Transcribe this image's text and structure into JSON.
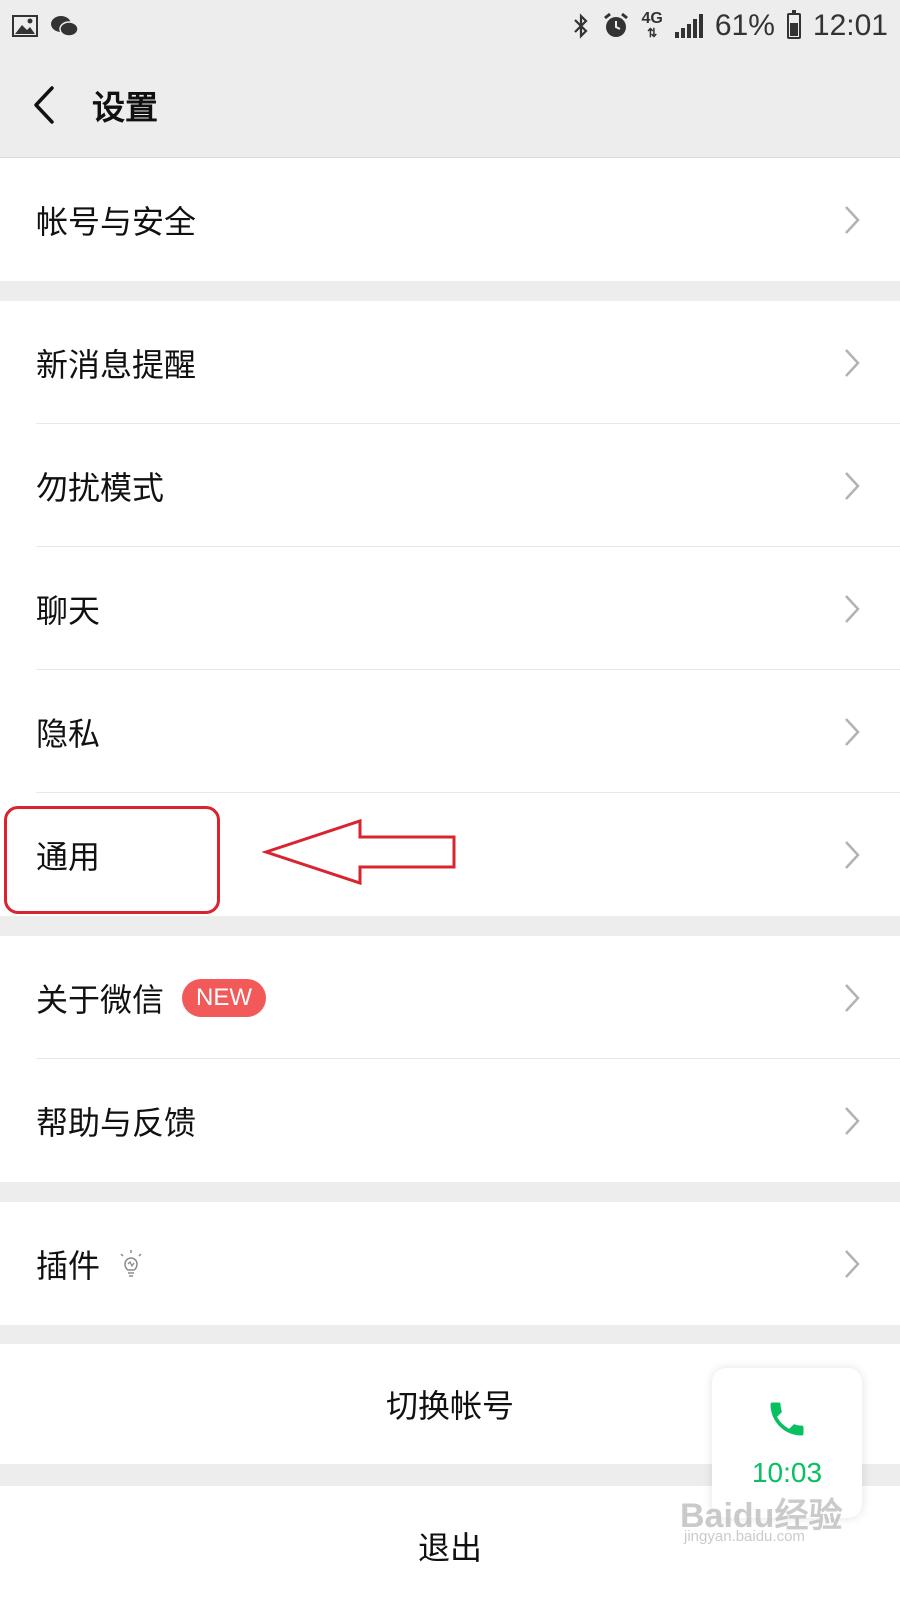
{
  "status_bar": {
    "battery": "61%",
    "time": "12:01",
    "network": "4G",
    "icons": [
      "gallery-icon",
      "wechat-icon",
      "bluetooth-icon",
      "alarm-icon",
      "signal-icon",
      "battery-icon"
    ]
  },
  "header": {
    "title": "设置",
    "back_icon": "chevron-left-icon"
  },
  "groups": [
    {
      "items": [
        {
          "label": "帐号与安全"
        }
      ]
    },
    {
      "items": [
        {
          "label": "新消息提醒"
        },
        {
          "label": "勿扰模式"
        },
        {
          "label": "聊天"
        },
        {
          "label": "隐私"
        },
        {
          "label": "通用"
        }
      ]
    },
    {
      "items": [
        {
          "label": "关于微信",
          "badge": "NEW"
        },
        {
          "label": "帮助与反馈"
        }
      ]
    },
    {
      "items": [
        {
          "label": "插件",
          "icon": "lightbulb-icon"
        }
      ]
    }
  ],
  "actions": {
    "switch_account": "切换帐号",
    "logout": "退出"
  },
  "call_widget": {
    "duration": "10:03",
    "icon": "phone-icon"
  },
  "watermark": {
    "text": "Baidu经验",
    "url": "jingyan.baidu.com"
  },
  "annotation": {
    "highlight_color": "#d9232e",
    "accent_green": "#07c160",
    "badge_color": "#f25a5a"
  }
}
